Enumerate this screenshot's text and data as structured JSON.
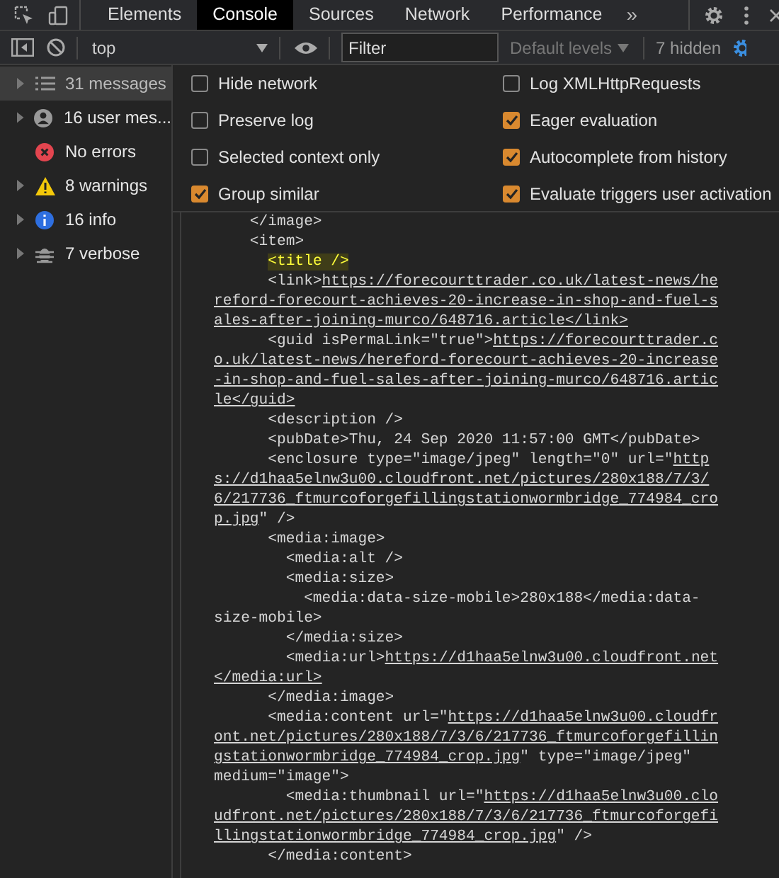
{
  "tabs": [
    {
      "label": "Elements",
      "selected": false
    },
    {
      "label": "Console",
      "selected": true
    },
    {
      "label": "Sources",
      "selected": false
    },
    {
      "label": "Network",
      "selected": false
    },
    {
      "label": "Performance",
      "selected": false
    }
  ],
  "more_tabs": "»",
  "toolbar": {
    "context": "top",
    "filter": {
      "placeholder": "Filter"
    },
    "levels": "Default levels",
    "hidden_count": "7 hidden"
  },
  "sidebar": {
    "items": [
      {
        "kind": "list",
        "label": "31 messages",
        "expandable": true,
        "selected": true
      },
      {
        "kind": "user",
        "label": "16 user mes...",
        "expandable": true,
        "selected": false
      },
      {
        "kind": "error",
        "label": "No errors",
        "expandable": false,
        "selected": false
      },
      {
        "kind": "warning",
        "label": "8 warnings",
        "expandable": true,
        "selected": false
      },
      {
        "kind": "info",
        "label": "16 info",
        "expandable": true,
        "selected": false
      },
      {
        "kind": "verbose",
        "label": "7 verbose",
        "expandable": true,
        "selected": false
      }
    ]
  },
  "settings": [
    {
      "label": "Hide network",
      "checked": false
    },
    {
      "label": "Log XMLHttpRequests",
      "checked": false
    },
    {
      "label": "Preserve log",
      "checked": false
    },
    {
      "label": "Eager evaluation",
      "checked": true
    },
    {
      "label": "Selected context only",
      "checked": false
    },
    {
      "label": "Autocomplete from history",
      "checked": true
    },
    {
      "label": "Group similar",
      "checked": true
    },
    {
      "label": "Evaluate triggers user activation",
      "checked": true
    }
  ],
  "console_lines": [
    [
      {
        "kind": "text",
        "text": "    </image>"
      }
    ],
    [
      {
        "kind": "text",
        "text": "    <item>"
      }
    ],
    [
      {
        "kind": "highlight",
        "text": "      <title />"
      }
    ],
    [
      {
        "kind": "text",
        "text": "      <link>"
      },
      {
        "kind": "link",
        "text": "https://forecourttrader.co.uk/latest-news/he"
      }
    ],
    [
      {
        "kind": "link",
        "text": "reford-forecourt-achieves-20-increase-in-shop-and-fuel-s"
      }
    ],
    [
      {
        "kind": "link",
        "text": "ales-after-joining-murco/648716.article</link>"
      }
    ],
    [
      {
        "kind": "text",
        "text": "      <guid isPermaLink=\"true\">"
      },
      {
        "kind": "link",
        "text": "https://forecourttrader.c"
      }
    ],
    [
      {
        "kind": "link",
        "text": "o.uk/latest-news/hereford-forecourt-achieves-20-increase"
      }
    ],
    [
      {
        "kind": "link",
        "text": "-in-shop-and-fuel-sales-after-joining-murco/648716.artic"
      }
    ],
    [
      {
        "kind": "link",
        "text": "le</guid>"
      }
    ],
    [
      {
        "kind": "text",
        "text": "      <description />"
      }
    ],
    [
      {
        "kind": "text",
        "text": "      <pubDate>Thu, 24 Sep 2020 11:57:00 GMT</pubDate>"
      }
    ],
    [
      {
        "kind": "text",
        "text": "      <enclosure type=\"image/jpeg\" length=\"0\" url=\""
      },
      {
        "kind": "link",
        "text": "http"
      }
    ],
    [
      {
        "kind": "link",
        "text": "s://d1haa5elnw3u00.cloudfront.net/pictures/280x188/7/3/"
      }
    ],
    [
      {
        "kind": "link",
        "text": "6/217736_ftmurcoforgefillingstationwormbridge_774984_cro"
      }
    ],
    [
      {
        "kind": "link",
        "text": "p.jpg"
      },
      {
        "kind": "text",
        "text": "\" />"
      }
    ],
    [
      {
        "kind": "text",
        "text": "      <media:image>"
      }
    ],
    [
      {
        "kind": "text",
        "text": "        <media:alt />"
      }
    ],
    [
      {
        "kind": "text",
        "text": "        <media:size>"
      }
    ],
    [
      {
        "kind": "text",
        "text": "          <media:data-size-mobile>280x188</media:data-"
      }
    ],
    [
      {
        "kind": "text",
        "text": "size-mobile>"
      }
    ],
    [
      {
        "kind": "text",
        "text": "        </media:size>"
      }
    ],
    [
      {
        "kind": "text",
        "text": "        <media:url>"
      },
      {
        "kind": "link",
        "text": "https://d1haa5elnw3u00.cloudfront.net"
      }
    ],
    [
      {
        "kind": "link",
        "text": "</media:url>"
      }
    ],
    [
      {
        "kind": "text",
        "text": "      </media:image>"
      }
    ],
    [
      {
        "kind": "text",
        "text": "      <media:content url=\""
      },
      {
        "kind": "link",
        "text": "https://d1haa5elnw3u00.cloudfr"
      }
    ],
    [
      {
        "kind": "link",
        "text": "ont.net/pictures/280x188/7/3/6/217736_ftmurcoforgefillin"
      }
    ],
    [
      {
        "kind": "link",
        "text": "gstationwormbridge_774984_crop.jpg"
      },
      {
        "kind": "text",
        "text": "\" type=\"image/jpeg\""
      }
    ],
    [
      {
        "kind": "text",
        "text": "medium=\"image\">"
      }
    ],
    [
      {
        "kind": "text",
        "text": "        <media:thumbnail url=\""
      },
      {
        "kind": "link",
        "text": "https://d1haa5elnw3u00.clo"
      }
    ],
    [
      {
        "kind": "link",
        "text": "udfront.net/pictures/280x188/7/3/6/217736_ftmurcoforgefi"
      }
    ],
    [
      {
        "kind": "link",
        "text": "llingstationwormbridge_774984_crop.jpg"
      },
      {
        "kind": "text",
        "text": "\" />"
      }
    ],
    [
      {
        "kind": "text",
        "text": "      </media:content>"
      }
    ]
  ]
}
